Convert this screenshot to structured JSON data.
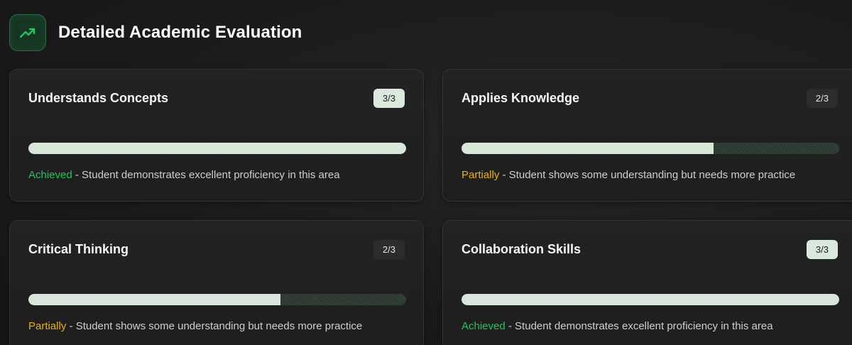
{
  "header": {
    "icon": "trending-up-icon",
    "title": "Detailed Academic Evaluation"
  },
  "colors": {
    "accent_green": "#22c55e",
    "accent_yellow": "#eab308",
    "progress_fill": "#d9e7db",
    "card_background": "#1f1f1f"
  },
  "cards": [
    {
      "title": "Understands Concepts",
      "score": "3/3",
      "progress_fraction": 1.0,
      "status": "Achieved",
      "description": " - Student demonstrates excellent proficiency in this area"
    },
    {
      "title": "Applies Knowledge",
      "score": "2/3",
      "progress_fraction": 0.667,
      "status": "Partially",
      "description": " - Student shows some understanding but needs more practice"
    },
    {
      "title": "Critical Thinking",
      "score": "2/3",
      "progress_fraction": 0.667,
      "status": "Partially",
      "description": " - Student shows some understanding but needs more practice"
    },
    {
      "title": "Collaboration Skills",
      "score": "3/3",
      "progress_fraction": 1.0,
      "status": "Achieved",
      "description": " - Student demonstrates excellent proficiency in this area"
    }
  ]
}
